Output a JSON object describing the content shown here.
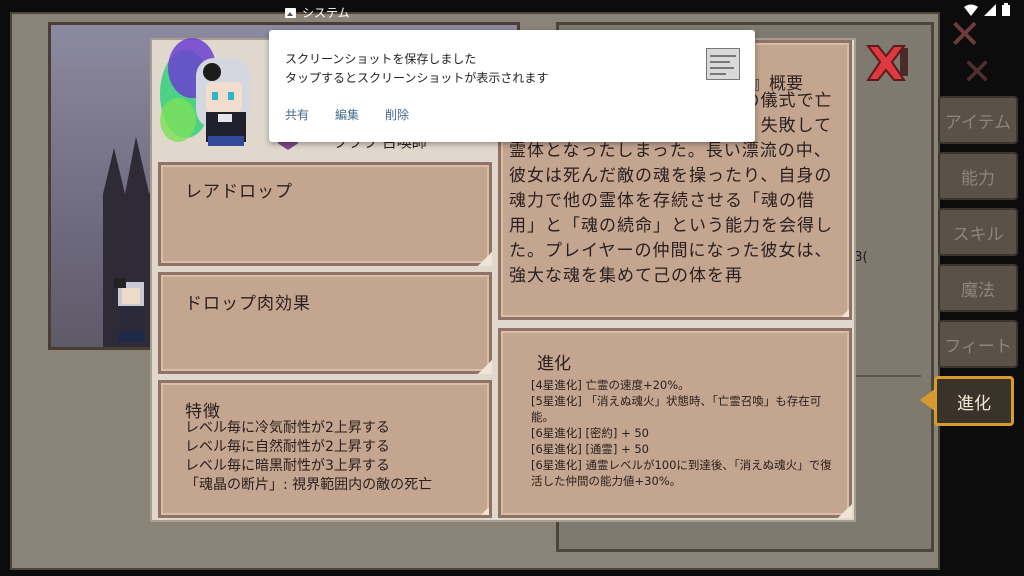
{
  "status_bar": {
    "app_name": "システム"
  },
  "notification": {
    "title": "スクリーンショットを保存しました",
    "subtitle": "タップするとスクリーンショットが表示されます",
    "actions": [
      "共有",
      "編集",
      "削除"
    ]
  },
  "tabs": [
    {
      "label": "アイテム",
      "active": false
    },
    {
      "label": "能力",
      "active": false
    },
    {
      "label": "スキル",
      "active": false
    },
    {
      "label": "魔法",
      "active": false
    },
    {
      "label": "フィート",
      "active": false
    },
    {
      "label": "進化",
      "active": true
    }
  ],
  "background": {
    "fragment_text": "r-3("
  },
  "character": {
    "class_label": "ラララ 召喚師"
  },
  "panels": {
    "rare_drop": {
      "title": "レアドロップ"
    },
    "meat_effect": {
      "title": "ドロップ肉効果"
    },
    "traits": {
      "title": "特徴",
      "lines": [
        "レベル毎に冷気耐性が2上昇する",
        "レベル毎に自然耐性が2上昇する",
        "レベル毎に暗黒耐性が3上昇する",
        "「魂晶の断片」: 視界範囲内の敵の死亡"
      ]
    },
    "description": {
      "title": "ス』概要",
      "text": "た亡霊魔法を研究していた古の儀式で亡き王を復活させようとしたが、失敗して霊体となったしまった。長い漂流の中、彼女は死んだ敵の魂を操ったり、自身の魂力で他の霊体を存続させる「魂の借用」と「魂の続命」という能力を会得した。プレイヤーの仲間になった彼女は、強大な魂を集めて己の体を再"
    },
    "evolution": {
      "title": "進化",
      "lines": [
        "[4星進化] 亡霊の速度+20%。",
        "[5星進化] 「消えぬ魂火」状態時、「亡霊召喚」も存在可能。",
        "[6星進化] [密約] + 50",
        "[6星進化] [通霊] + 50",
        "[6星進化] 通霊レベルが100に到達後、「消えぬ魂火」で復活した仲間の能力値+30%。"
      ]
    }
  },
  "colors": {
    "panel_fill": "#c4a58f",
    "panel_border": "#8f7365",
    "dialog_bg": "#e0d8cc",
    "active_tab_border": "#d69b2c",
    "close_red": "#e0383e",
    "notif_action": "#476a8a"
  }
}
